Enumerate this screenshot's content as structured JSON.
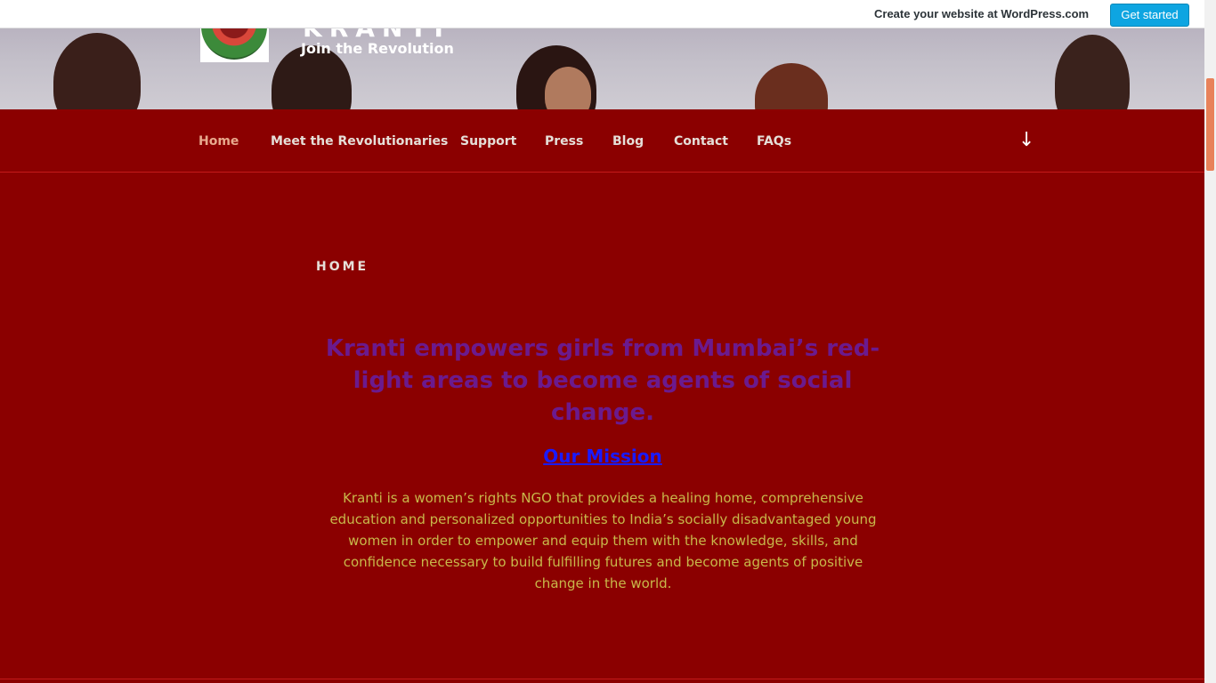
{
  "wpbar": {
    "create_text": "Create your website at WordPress.com",
    "cta_label": "Get started",
    "cta_color": "#0ea5e1"
  },
  "site": {
    "title": "KRANTI",
    "tagline": "Join the Revolution"
  },
  "nav": {
    "items": [
      {
        "label": "Home",
        "current": true
      },
      {
        "label": "Meet the Revolutionaries"
      },
      {
        "label": "Support"
      },
      {
        "label": "Press"
      },
      {
        "label": "Blog"
      },
      {
        "label": "Contact"
      },
      {
        "label": "FAQs"
      }
    ],
    "scroll_icon": "arrow-down-icon"
  },
  "main": {
    "page_title": "HOME",
    "lead": "Kranti empowers girls from Mumbai’s red-light areas to become agents of social change.",
    "mission_heading": "Our Mission",
    "mission_text": "Kranti is a women’s rights NGO that provides a healing home, comprehensive education and personalized opportunities to India’s socially disadvantaged young women in order to empower and equip them with the knowledge, skills, and confidence necessary to build fulfilling futures and become agents of positive change in the world."
  },
  "colors": {
    "background": "#8b0000",
    "lead": "#6b1a8e",
    "mission_heading": "#1a1aff",
    "mission_text": "#c8b84a"
  }
}
